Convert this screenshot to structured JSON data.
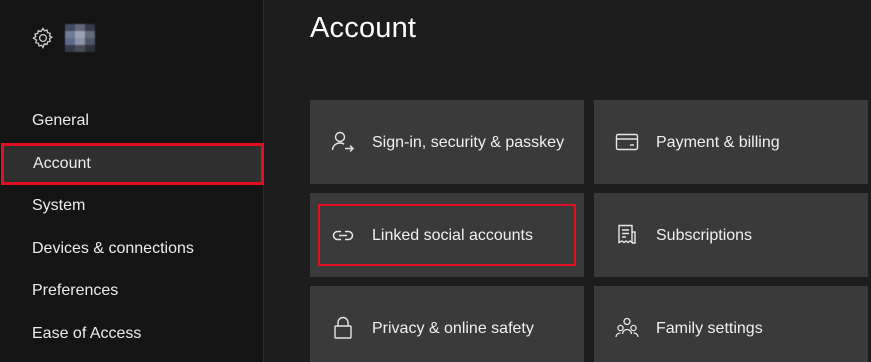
{
  "page": {
    "title": "Account"
  },
  "sidebar": {
    "items": [
      {
        "label": "General"
      },
      {
        "label": "Account"
      },
      {
        "label": "System"
      },
      {
        "label": "Devices & connections"
      },
      {
        "label": "Preferences"
      },
      {
        "label": "Ease of Access"
      }
    ],
    "active_item": "Account",
    "highlight_color": "#e01020"
  },
  "tiles": {
    "signin": {
      "label": "Sign-in, security & passkey",
      "icon": "person-arrow-icon"
    },
    "payment": {
      "label": "Payment & billing",
      "icon": "card-icon"
    },
    "linked": {
      "label": "Linked social accounts",
      "icon": "link-icon"
    },
    "subscriptions": {
      "label": "Subscriptions",
      "icon": "receipt-icon"
    },
    "privacy": {
      "label": "Privacy & online safety",
      "icon": "lock-icon"
    },
    "family": {
      "label": "Family settings",
      "icon": "people-icon"
    }
  }
}
